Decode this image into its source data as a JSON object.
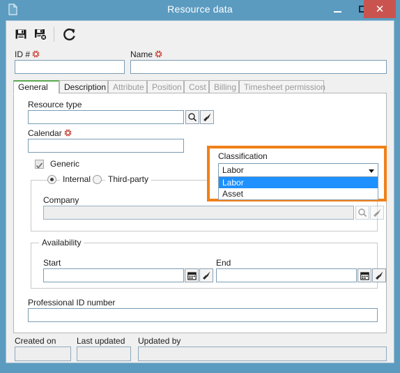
{
  "window": {
    "title": "Resource data",
    "doc_icon": "document-icon",
    "controls": {
      "minimize": "–",
      "maximize": "□",
      "close": "✕"
    }
  },
  "toolbar": {
    "buttons": [
      {
        "name": "save-button",
        "icon": "save-icon",
        "tooltip": "Save"
      },
      {
        "name": "save-and-close-button",
        "icon": "save-close-icon",
        "tooltip": "Save and close"
      },
      {
        "name": "refresh-button",
        "icon": "refresh-icon",
        "tooltip": "Refresh"
      }
    ]
  },
  "header_fields": {
    "id": {
      "label": "ID #",
      "value": "",
      "required": true
    },
    "name": {
      "label": "Name",
      "value": "",
      "required": true
    }
  },
  "tabs": [
    {
      "label": "General",
      "state": "active"
    },
    {
      "label": "Description",
      "state": "enabled"
    },
    {
      "label": "Attribute",
      "state": "disabled"
    },
    {
      "label": "Position",
      "state": "disabled"
    },
    {
      "label": "Cost",
      "state": "disabled"
    },
    {
      "label": "Billing",
      "state": "disabled"
    },
    {
      "label": "Timesheet permission",
      "state": "disabled"
    }
  ],
  "general_tab": {
    "resource_type": {
      "label": "Resource type",
      "value": "",
      "required": false
    },
    "calendar": {
      "label": "Calendar",
      "value": "",
      "required": true
    },
    "classification": {
      "label": "Classification",
      "value": "Labor",
      "expanded": true,
      "options": [
        "Labor",
        "Asset"
      ],
      "selected_index": 0,
      "highlight_color": "#f08018"
    },
    "generic": {
      "label": "Generic",
      "checked": true,
      "enabled": false
    },
    "source": {
      "options": [
        {
          "label": "Internal",
          "selected": true
        },
        {
          "label": "Third-party",
          "selected": false
        }
      ]
    },
    "company": {
      "label": "Company",
      "value": "",
      "enabled": false
    },
    "availability": {
      "legend": "Availability",
      "start": {
        "label": "Start",
        "value": ""
      },
      "end": {
        "label": "End",
        "value": ""
      }
    },
    "professional_id": {
      "label": "Professional ID number",
      "value": ""
    }
  },
  "footer": {
    "created_on": {
      "label": "Created on",
      "value": ""
    },
    "last_updated": {
      "label": "Last updated",
      "value": ""
    },
    "updated_by": {
      "label": "Updated by",
      "value": ""
    }
  },
  "icons": {
    "search": "search-icon",
    "clear_brush": "brush-icon",
    "calendar": "calendar-icon",
    "dropdown_arrow": "chevron-down-icon",
    "required_marker": "required-asterisk-icon"
  },
  "colors": {
    "titlebar": "#5b9bc0",
    "close_button": "#c9544f",
    "highlight": "#f08018",
    "selection": "#1e90ff",
    "active_tab_accent": "#5aa74f"
  }
}
